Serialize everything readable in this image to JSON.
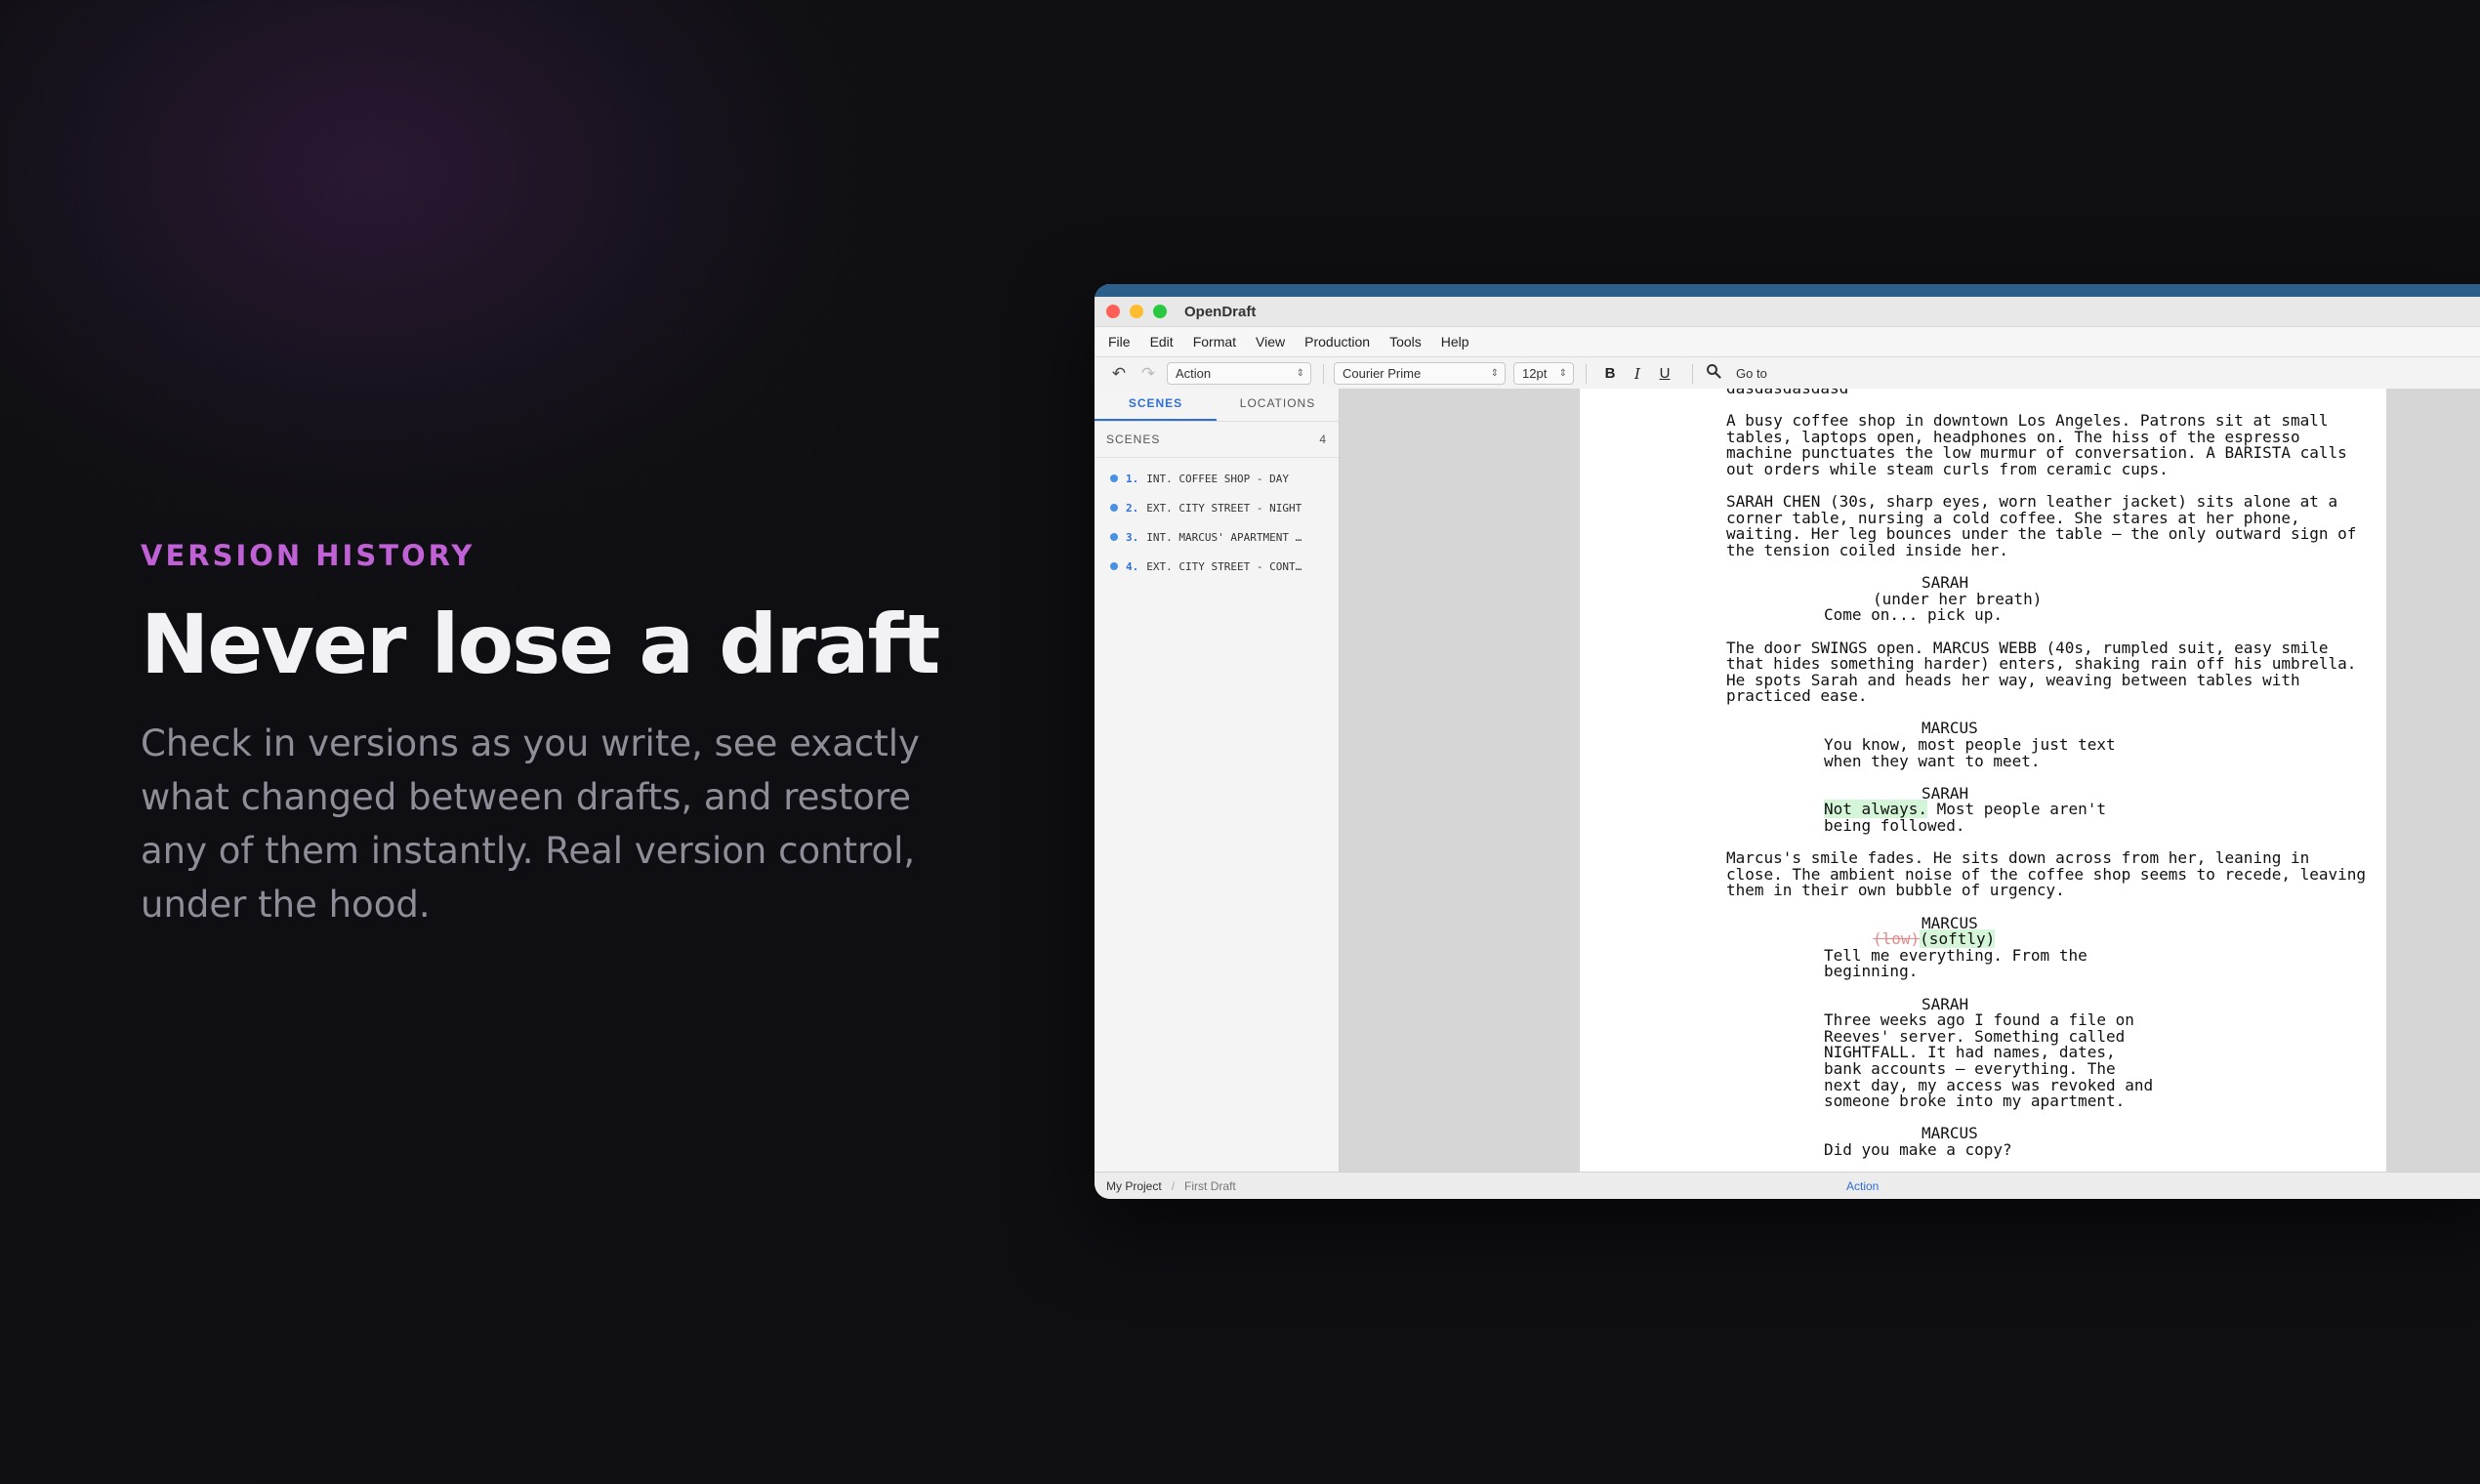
{
  "hero": {
    "eyebrow": "VERSION HISTORY",
    "headline": "Never lose a draft",
    "description": "Check in versions as you write, see exactly what changed between drafts, and restore any of them instantly. Real version control, under the hood."
  },
  "window": {
    "title": "OpenDraft",
    "menu": [
      "File",
      "Edit",
      "Format",
      "View",
      "Production",
      "Tools",
      "Help"
    ],
    "toolbar": {
      "element_type": "Action",
      "font": "Courier Prime",
      "size": "12pt",
      "bold": "B",
      "italic": "I",
      "underline": "U",
      "goto": "Go to"
    },
    "sidebar": {
      "tabs": [
        "SCENES",
        "LOCATIONS"
      ],
      "section_label": "SCENES",
      "count": "4",
      "scenes": [
        {
          "num": "1.",
          "label": "INT. COFFEE SHOP - DAY"
        },
        {
          "num": "2.",
          "label": "EXT. CITY STREET - NIGHT"
        },
        {
          "num": "3.",
          "label": "INT. MARCUS' APARTMENT …"
        },
        {
          "num": "4.",
          "label": "EXT. CITY STREET - CONT…"
        }
      ]
    },
    "script": {
      "top_fragment": "dasdasdasdasd",
      "action1": "A busy coffee shop in downtown Los Angeles. Patrons sit at small tables, laptops open, headphones on. The hiss of the espresso machine punctuates the low murmur of conversation. A BARISTA calls out orders while steam curls from ceramic cups.",
      "action2": "SARAH CHEN (30s, sharp eyes, worn leather jacket) sits alone at a corner table, nursing a cold coffee. She stares at her phone, waiting. Her leg bounces under the table — the only outward sign of the tension coiled inside her.",
      "char1": "SARAH",
      "paren1": "(under her breath)",
      "dlg1": "Come on... pick up.",
      "action3": "The door SWINGS open. MARCUS WEBB (40s, rumpled suit, easy smile that hides something harder) enters, shaking rain off his umbrella. He spots Sarah and heads her way, weaving between tables with practiced ease.",
      "char2": "MARCUS",
      "dlg2": "You know, most people just text when they want to meet.",
      "char3": "SARAH",
      "dlg3_added": "Not always.",
      "dlg3_rest": " Most people aren't being followed.",
      "action4": "Marcus's smile fades. He sits down across from her, leaning in close. The ambient noise of the coffee shop seems to recede, leaving them in their own bubble of urgency.",
      "char4": "MARCUS",
      "paren4_deleted": "(low)",
      "paren4_added": "(softly)",
      "dlg4": "Tell me everything. From the beginning.",
      "char5": "SARAH",
      "dlg5": "Three weeks ago I found a file on Reeves' server. Something called NIGHTFALL. It had names, dates, bank accounts — everything. The next day, my access was revoked and someone broke into my apartment.",
      "char6": "MARCUS",
      "dlg6": "Did you make a copy?"
    },
    "status": {
      "project": "My Project",
      "draft": "First Draft",
      "mode": "Action"
    }
  }
}
